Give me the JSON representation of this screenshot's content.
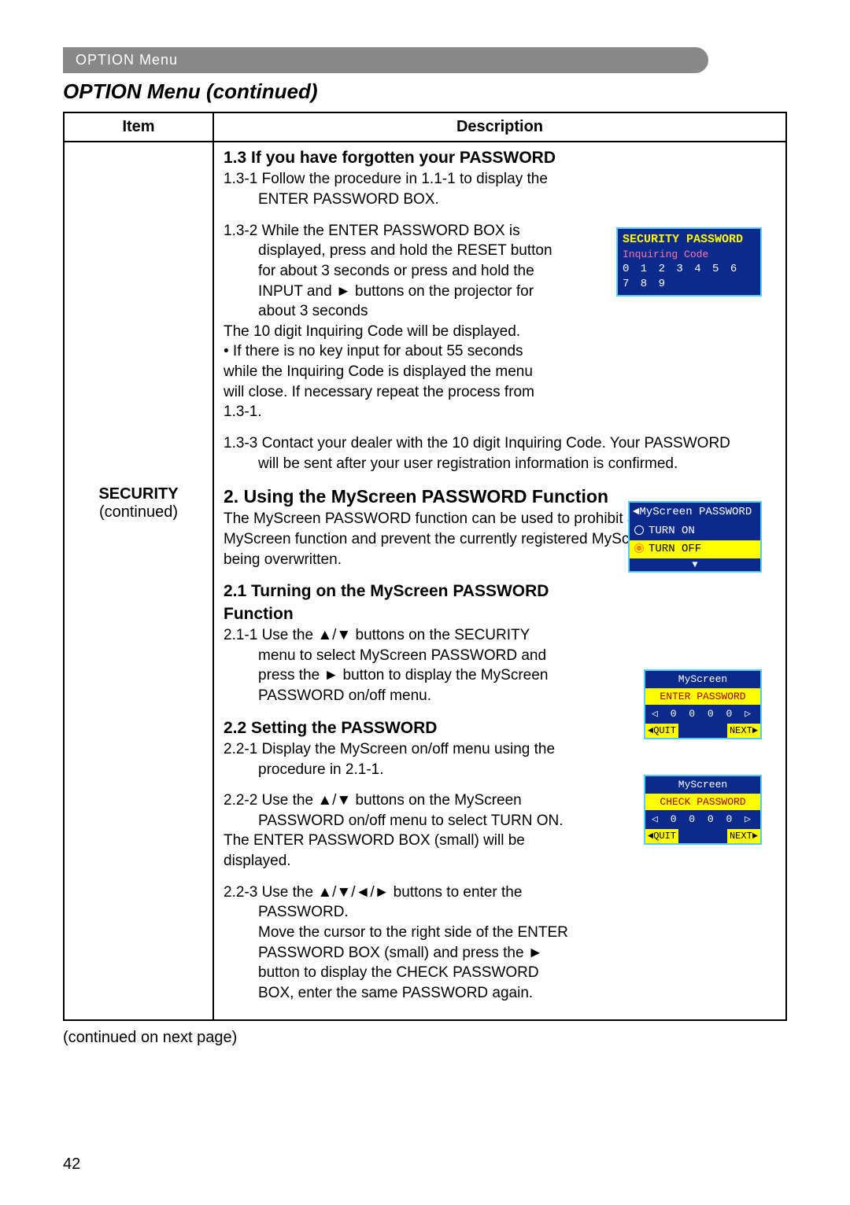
{
  "tab": "OPTION Menu",
  "title": "OPTION Menu (continued)",
  "headers": {
    "item": "Item",
    "desc": "Description"
  },
  "item": {
    "name": "SECURITY",
    "sub": "(continued)"
  },
  "s13": {
    "h": "1.3 If you have forgotten your PASSWORD",
    "p1a": "1.3-1 Follow the procedure in 1.1-1 to display the",
    "p1b": "ENTER PASSWORD BOX.",
    "p2a": "1.3-2 While the ENTER PASSWORD BOX is",
    "p2b": "displayed, press and hold the RESET button for about 3 seconds or press and hold the INPUT and ► buttons on the projector for about 3 seconds",
    "p2c": "The 10 digit Inquiring Code will be displayed.",
    "p2d": "• If there is no key input for about 55 seconds while the Inquiring Code is displayed the menu will close. If necessary repeat the process from 1.3-1.",
    "p3a": "1.3-3 Contact your dealer with the 10 digit Inquiring Code. Your PASSWORD",
    "p3b": "will be sent after your user registration information is confirmed."
  },
  "s2": {
    "h": "2. Using the MyScreen PASSWORD Function",
    "intro": "The MyScreen PASSWORD function can be used to prohibit access to the MyScreen function and prevent the currently registered MyScreen image from being overwritten."
  },
  "s21": {
    "h": "2.1 Turning on the MyScreen PASSWORD Function",
    "p1": "2.1-1 Use the ▲/▼ buttons on the SECURITY",
    "p1b": "menu to select MyScreen PASSWORD and press the ► button to display the MyScreen PASSWORD on/off menu."
  },
  "s22": {
    "h": "2.2 Setting the PASSWORD",
    "p1": "2.2-1 Display the MyScreen on/off menu using the",
    "p1b": "procedure in 2.1-1.",
    "p2": "2.2-2 Use the ▲/▼ buttons on the MyScreen",
    "p2b": "PASSWORD on/off menu to select TURN ON.",
    "p2c": "The ENTER PASSWORD BOX (small) will be displayed.",
    "p3": "2.2-3 Use the ▲/▼/◄/► buttons to enter the",
    "p3b": "PASSWORD.",
    "p3c": "Move the cursor to the right side of the ENTER PASSWORD BOX (small) and press the ► button to display the CHECK PASSWORD BOX, enter the same PASSWORD again."
  },
  "footer": "(continued on next page)",
  "pagenum": "42",
  "osd_inq": {
    "title": "SECURITY PASSWORD",
    "sub": "Inquiring Code",
    "code": "0 1  2 3 4 5  6 7 8 9"
  },
  "osd_menu": {
    "title": "◄MyScreen PASSWORD",
    "on": "TURN ON",
    "off": "TURN OFF"
  },
  "osd_enter": {
    "t1": "MyScreen",
    "t2": "ENTER PASSWORD",
    "digits": "0  0  0  0",
    "quit": "◄QUIT",
    "next": "NEXT►"
  },
  "osd_check": {
    "t1": "MyScreen",
    "t2": "CHECK PASSWORD",
    "digits": "0  0  0  0",
    "quit": "◄QUIT",
    "next": "NEXT►"
  }
}
